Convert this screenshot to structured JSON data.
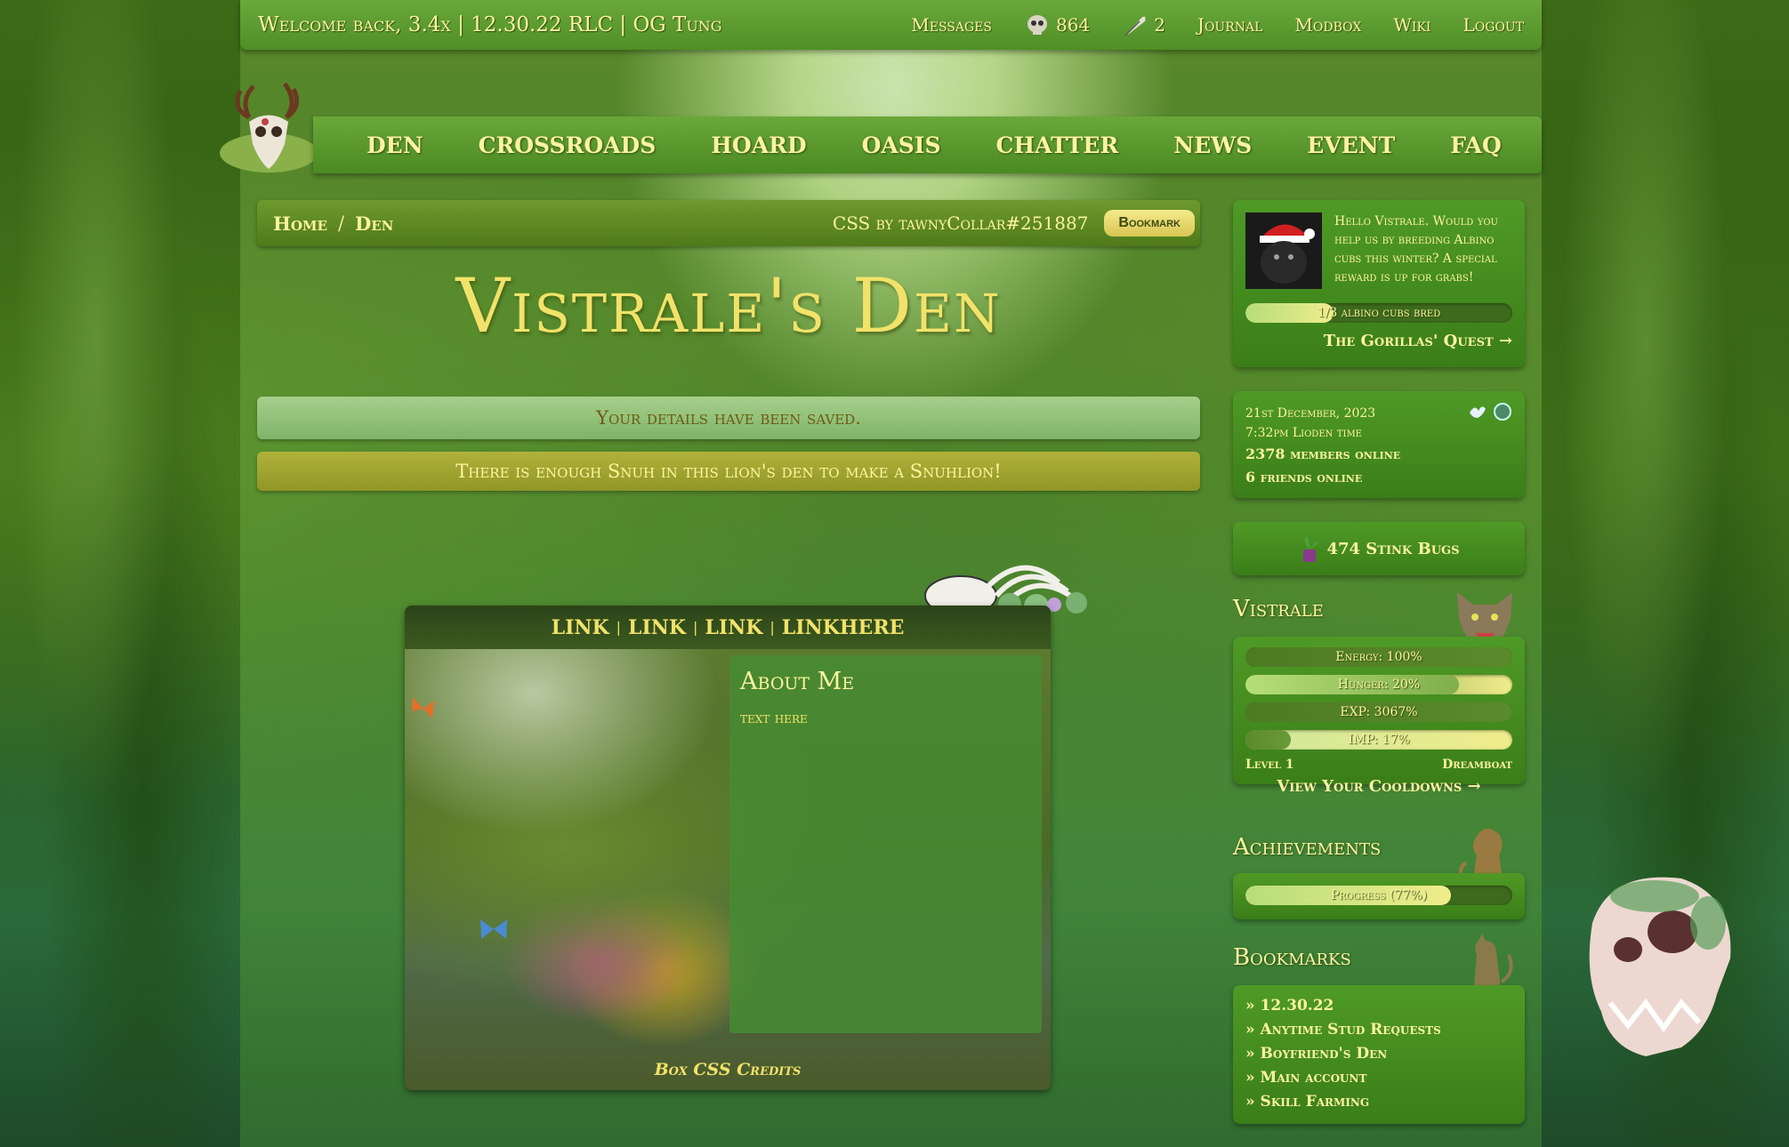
{
  "topbar": {
    "welcome": "Welcome back, 3.4x | 12.30.22 RLC | OG Tung",
    "messages": "Messages",
    "currency_count": "864",
    "feather_count": "2",
    "journal": "Journal",
    "modbox": "Modbox",
    "wiki": "Wiki",
    "logout": "Logout"
  },
  "mainnav": [
    "DEN",
    "CROSSROADS",
    "HOARD",
    "OASIS",
    "CHATTER",
    "NEWS",
    "EVENT",
    "FAQ"
  ],
  "breadcrumb": {
    "home": "Home",
    "sep": "/",
    "current": "Den",
    "css_credit": "CSS by tawnyCollar#251887",
    "bookmark": "Bookmark"
  },
  "den_title": "Vistrale's Den",
  "notices": {
    "saved": "Your details have been saved.",
    "snuh": "There is enough Snuh in this lion's den to make a Snuhlion!"
  },
  "custom_box": {
    "links": [
      "LINK",
      "LINK",
      "LINK",
      "LINKHERE"
    ],
    "pipe": "|",
    "about_title": "About Me",
    "about_text": "text here",
    "credits": "Box CSS Credits"
  },
  "quest": {
    "text": "Hello Vistrale. Would you help us by breeding Albino cubs this winter? A special reward is up for grabs!",
    "progress_label": "1/3 albino cubs bred",
    "progress": 0.33,
    "link": "The Gorillas' Quest →"
  },
  "time": {
    "date": "21st December, 2023",
    "clock": "7:32pm Lioden time",
    "members": "2378 members online",
    "friends": "6 friends online"
  },
  "stink_bugs": "474 Stink Bugs",
  "lion": {
    "name": "Vistrale",
    "energy": {
      "label": "Energy: 100%",
      "value": 1.0
    },
    "hunger": {
      "label": "Hunger: 20%",
      "value": 0.2
    },
    "exp": {
      "label": "EXP: 3067%",
      "value": 1.0
    },
    "imp": {
      "label": "IMP: 17%",
      "value": 0.17
    },
    "level": "Level 1",
    "title": "Dreamboat",
    "cooldowns": "View Your Cooldowns →"
  },
  "achievements": {
    "title": "Achievements",
    "progress_label": "Progress (77%)",
    "progress": 0.77
  },
  "bookmarks": {
    "title": "Bookmarks",
    "items": [
      "» 12.30.22",
      "» Anytime Stud Requests",
      "» Boyfriend's Den",
      "» Main account",
      "» Skill Farming"
    ]
  },
  "colors": {
    "accent_text": "#fff3a0",
    "panel_green": "#4f9a26",
    "notice_green": "#a6cf8a",
    "notice_olive": "#b0b23a"
  }
}
